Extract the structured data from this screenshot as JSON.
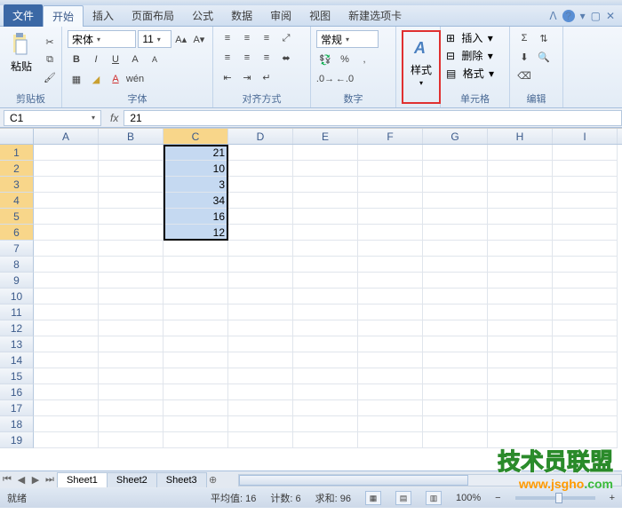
{
  "tabs": {
    "file": "文件",
    "home": "开始",
    "insert": "插入",
    "layout": "页面布局",
    "formulas": "公式",
    "data": "数据",
    "review": "审阅",
    "view": "视图",
    "newtab": "新建选项卡"
  },
  "ribbon": {
    "clipboard": {
      "paste": "粘贴",
      "label": "剪贴板"
    },
    "font": {
      "name": "宋体",
      "size": "11",
      "label": "字体"
    },
    "align": {
      "label": "对齐方式"
    },
    "number": {
      "format": "常规",
      "label": "数字"
    },
    "styles": {
      "btn": "样式",
      "label": ""
    },
    "cells": {
      "insert": "插入",
      "delete": "删除",
      "format": "格式",
      "label": "单元格"
    },
    "editing": {
      "label": "编辑"
    }
  },
  "name_box": "C1",
  "formula": "21",
  "columns": [
    "A",
    "B",
    "C",
    "D",
    "E",
    "F",
    "G",
    "H",
    "I"
  ],
  "row_count": 19,
  "selected_col": 2,
  "selected_rows": [
    0,
    1,
    2,
    3,
    4,
    5
  ],
  "cells": {
    "C1": "21",
    "C2": "10",
    "C3": "3",
    "C4": "34",
    "C5": "16",
    "C6": "12"
  },
  "chart_data": {
    "type": "table",
    "categories": [
      "C"
    ],
    "values": [
      21,
      10,
      3,
      34,
      16,
      12
    ]
  },
  "sheets": {
    "s1": "Sheet1",
    "s2": "Sheet2",
    "s3": "Sheet3"
  },
  "status": {
    "ready": "就绪",
    "avg_label": "平均值:",
    "avg": "16",
    "count_label": "计数:",
    "count": "6",
    "sum_label": "求和:",
    "sum": "96",
    "zoom": "100%"
  },
  "watermark": {
    "text": "技术员联盟",
    "url1": "www.",
    "url2": "jsgho",
    "url3": ".com"
  }
}
